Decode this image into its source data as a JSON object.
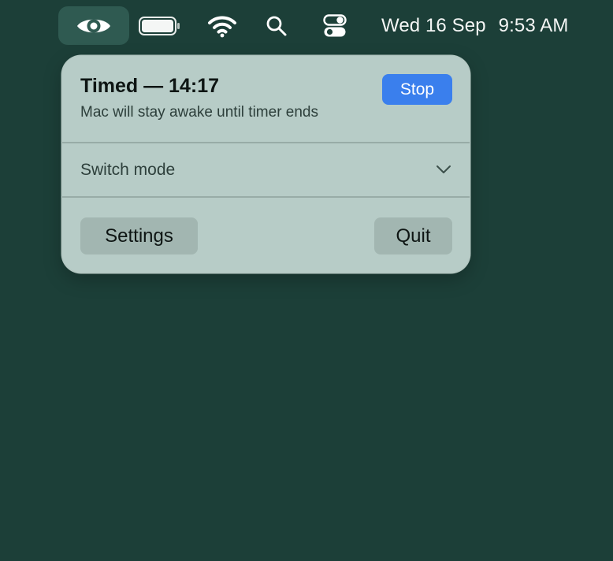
{
  "menubar": {
    "status_item_icon": "eye-icon",
    "battery_icon": "battery-icon",
    "wifi_icon": "wifi-icon",
    "search_icon": "search-icon",
    "control_center_icon": "control-center-icon",
    "date": "Wed 16 Sep",
    "time": "9:53 AM"
  },
  "panel": {
    "title": "Timed — 14:17",
    "subtitle": "Mac will stay awake until timer ends",
    "stop_label": "Stop",
    "mode_label": "Switch mode",
    "mode_icon": "chevron-down-icon",
    "settings_label": "Settings",
    "quit_label": "Quit"
  },
  "colors": {
    "desktop": "#1c3f38",
    "panel": "#b7ccc7",
    "accent": "#3a7fed",
    "button": "#a2b6b1"
  }
}
